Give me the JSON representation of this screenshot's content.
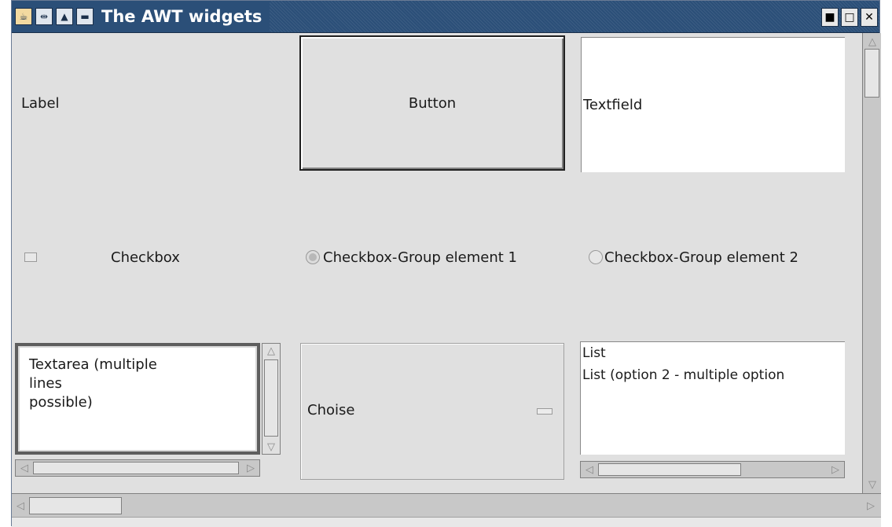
{
  "window": {
    "title": "The AWT widgets"
  },
  "titlebar": {
    "left_icons": [
      "java-app-icon",
      "pin-icon",
      "shade-up-icon",
      "minimize-icon"
    ],
    "right_icons": [
      "minimize-window-icon",
      "maximize-window-icon",
      "close-window-icon"
    ],
    "right_glyphs": [
      "■",
      "□",
      "✕"
    ]
  },
  "widgets": {
    "label": "Label",
    "button": "Button",
    "textfield": "Textfield",
    "checkbox": "Checkbox",
    "radio1": "Checkbox-Group element 1",
    "radio2": "Checkbox-Group element 2",
    "textarea": "Textarea (multiple\nlines\npossible)",
    "choice": "Choise",
    "list_items": [
      "List",
      "List (option 2 - multiple option"
    ]
  },
  "colors": {
    "titlebar": "#2b4f78",
    "background": "#e0e0e0"
  }
}
